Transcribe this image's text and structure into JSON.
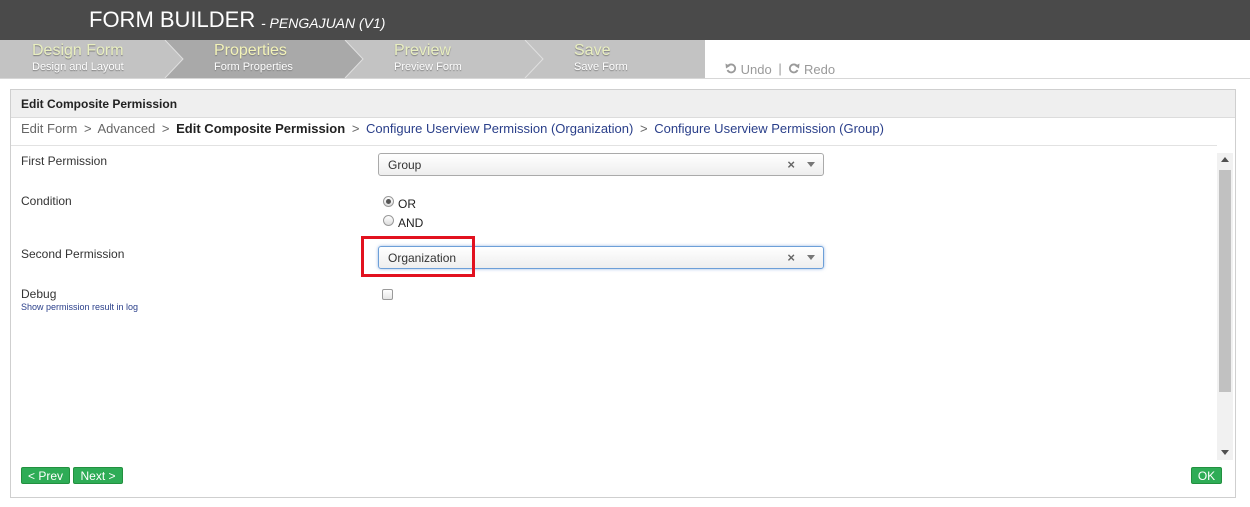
{
  "header": {
    "title": "FORM BUILDER",
    "subtitle": "- PENGAJUAN (V1)"
  },
  "steps": [
    {
      "title": "Design Form",
      "subtitle": "Design and Layout"
    },
    {
      "title": "Properties",
      "subtitle": "Form Properties"
    },
    {
      "title": "Preview",
      "subtitle": "Preview Form"
    },
    {
      "title": "Save",
      "subtitle": "Save Form"
    }
  ],
  "toolbar": {
    "undo_label": "Undo",
    "separator": "|",
    "redo_label": "Redo"
  },
  "panel": {
    "title": "Edit Composite Permission"
  },
  "breadcrumb": {
    "items": [
      "Edit Form",
      "Advanced",
      "Edit Composite Permission",
      "Configure Userview Permission (Organization)",
      "Configure Userview Permission (Group)"
    ],
    "separator": ">"
  },
  "form": {
    "first_permission": {
      "label": "First Permission",
      "value": "Group",
      "clear": "×"
    },
    "condition": {
      "label": "Condition",
      "options": [
        "OR",
        "AND"
      ],
      "selected": "OR"
    },
    "second_permission": {
      "label": "Second Permission",
      "value": "Organization",
      "clear": "×"
    },
    "debug": {
      "label": "Debug",
      "hint": "Show permission result in log",
      "checked": false
    }
  },
  "buttons": {
    "prev": "< Prev",
    "next": "Next >",
    "ok": "OK"
  },
  "colors": {
    "topbar": "#4a4a4a",
    "button": "#2eac56",
    "highlight": "#e2111f",
    "link": "#2a3f8a"
  }
}
